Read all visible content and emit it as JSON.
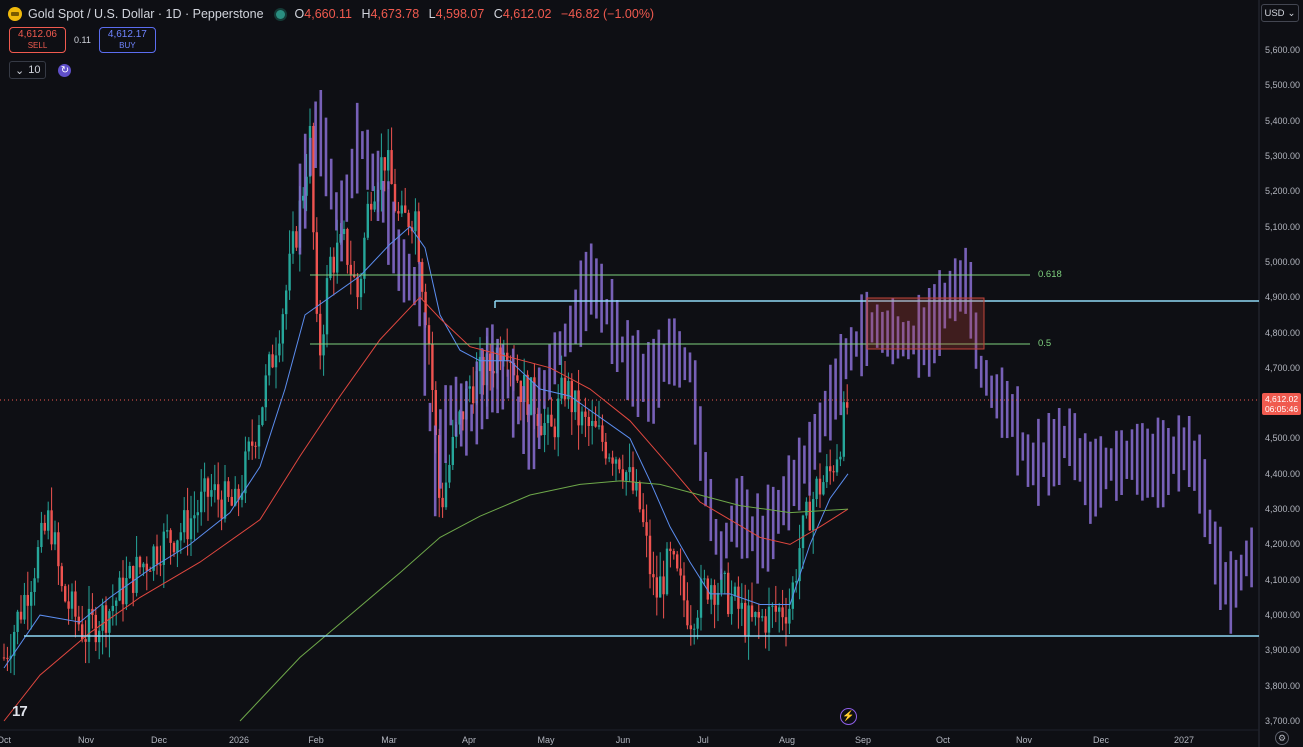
{
  "header": {
    "symbol_title": "Gold Spot / U.S. Dollar · 1D · Pepperstone",
    "open_label": "O",
    "open": "4,660.11",
    "high_label": "H",
    "high": "4,673.78",
    "low_label": "L",
    "low": "4,598.07",
    "close_label": "C",
    "close": "4,612.02",
    "change": "−46.82 (−1.00%)"
  },
  "trade": {
    "sell_price": "4,612.06",
    "sell_label": "SELL",
    "spread": "0.11",
    "buy_price": "4,612.17",
    "buy_label": "BUY"
  },
  "indicator": {
    "interval_value": "10"
  },
  "price_axis": {
    "currency": "USD",
    "ticks": [
      "5,600.00",
      "5,500.00",
      "5,400.00",
      "5,300.00",
      "5,200.00",
      "5,100.00",
      "5,000.00",
      "4,900.00",
      "4,800.00",
      "4,700.00",
      "4,600.00",
      "4,500.00",
      "4,400.00",
      "4,300.00",
      "4,200.00",
      "4,100.00",
      "4,000.00",
      "3,900.00",
      "3,800.00",
      "3,700.00"
    ],
    "current_price": "4,612.02",
    "countdown": "06:05:46"
  },
  "time_axis": {
    "labels": [
      "Oct",
      "Nov",
      "Dec",
      "2026",
      "Feb",
      "Mar",
      "Apr",
      "May",
      "Jun",
      "Jul",
      "Aug",
      "Sep",
      "Oct",
      "Nov",
      "Dec",
      "2027"
    ]
  },
  "drawings": {
    "fib_upper": "0.618",
    "fib_lower": "0.5"
  },
  "colors": {
    "bull": "#26a69a",
    "bear": "#ef5350",
    "projection": "#8a6fd4",
    "ma_fast": "#5b8def",
    "ma_mid": "#e0473f",
    "ma_slow": "#6ea84a",
    "hline": "#8fd8f5",
    "fib": "#7ed07e",
    "zone": "#c0453a",
    "background": "#0e0f14"
  }
}
